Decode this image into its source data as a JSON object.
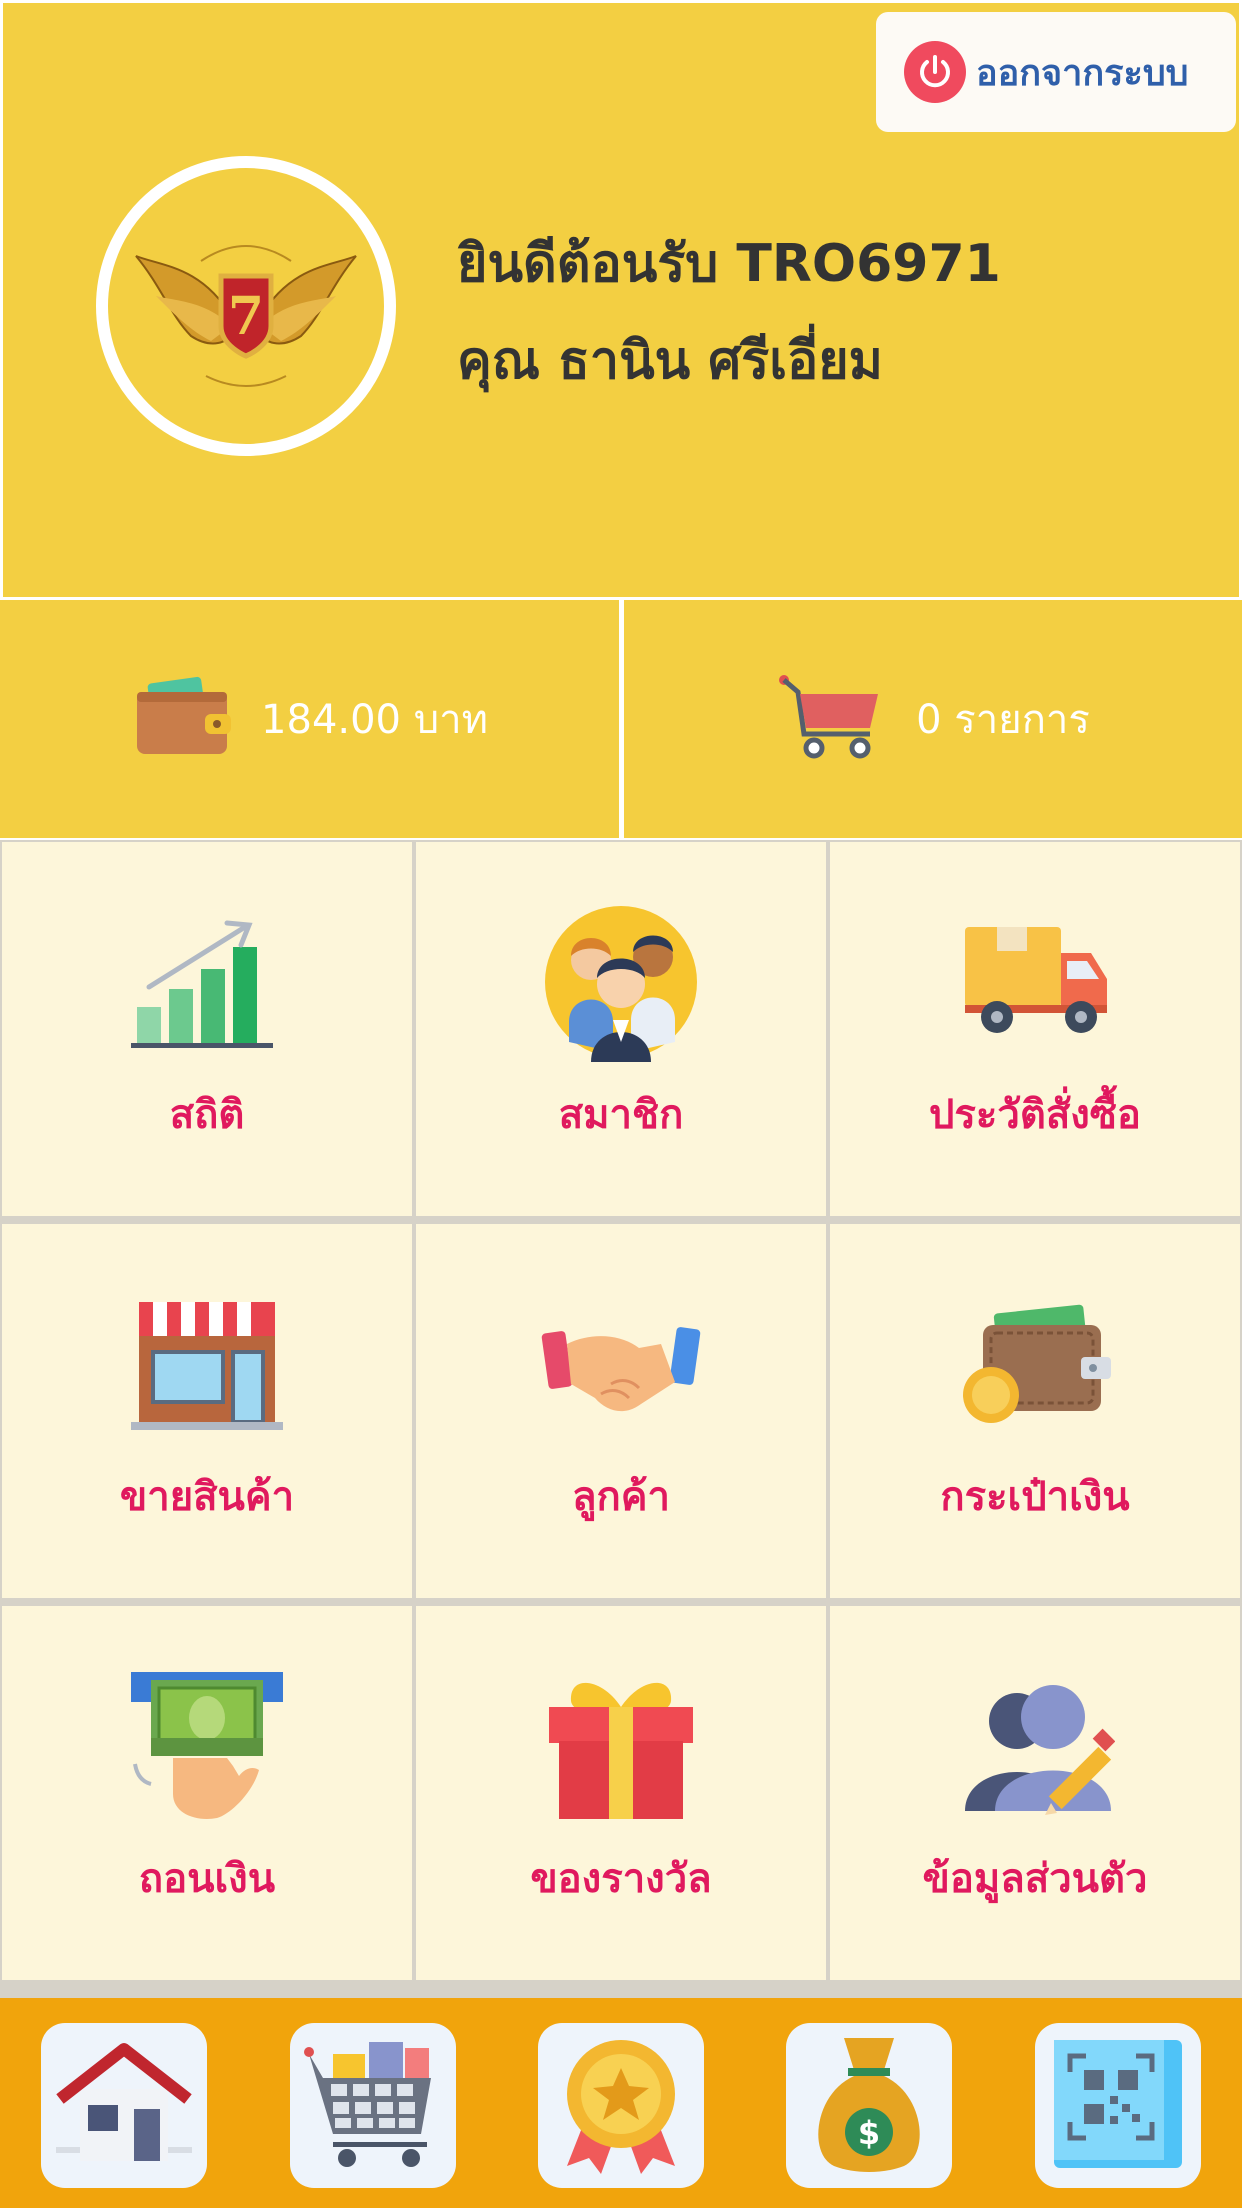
{
  "header": {
    "logout_label": "ออกจากระบบ",
    "welcome": "ยินดีต้อนรับ TRO6971",
    "name": "คุณ ธานิน ศรีเอี่ยม"
  },
  "stats": {
    "balance": "184.00 บาท",
    "cart": "0 รายการ"
  },
  "menu": [
    {
      "label": "สถิติ",
      "icon": "statistics-chart-icon"
    },
    {
      "label": "สมาชิก",
      "icon": "members-icon"
    },
    {
      "label": "ประวัติสั่งซื้อ",
      "icon": "delivery-truck-icon"
    },
    {
      "label": "ขายสินค้า",
      "icon": "shop-icon"
    },
    {
      "label": "ลูกค้า",
      "icon": "handshake-icon"
    },
    {
      "label": "กระเป๋าเงิน",
      "icon": "wallet-icon"
    },
    {
      "label": "ถอนเงิน",
      "icon": "withdraw-cash-icon"
    },
    {
      "label": "ของรางวัล",
      "icon": "gift-icon"
    },
    {
      "label": "ข้อมูลส่วนตัว",
      "icon": "profile-icon"
    }
  ],
  "bottom_nav": [
    "home-icon",
    "cart-icon",
    "award-medal-icon",
    "money-bag-icon",
    "qr-code-icon"
  ],
  "colors": {
    "header_bg": "#f3cf42",
    "grid_bg": "#fdf6da",
    "label_color": "#e0195e",
    "bottom_bar": "#f1a40c",
    "logout_text": "#2f5faa"
  }
}
